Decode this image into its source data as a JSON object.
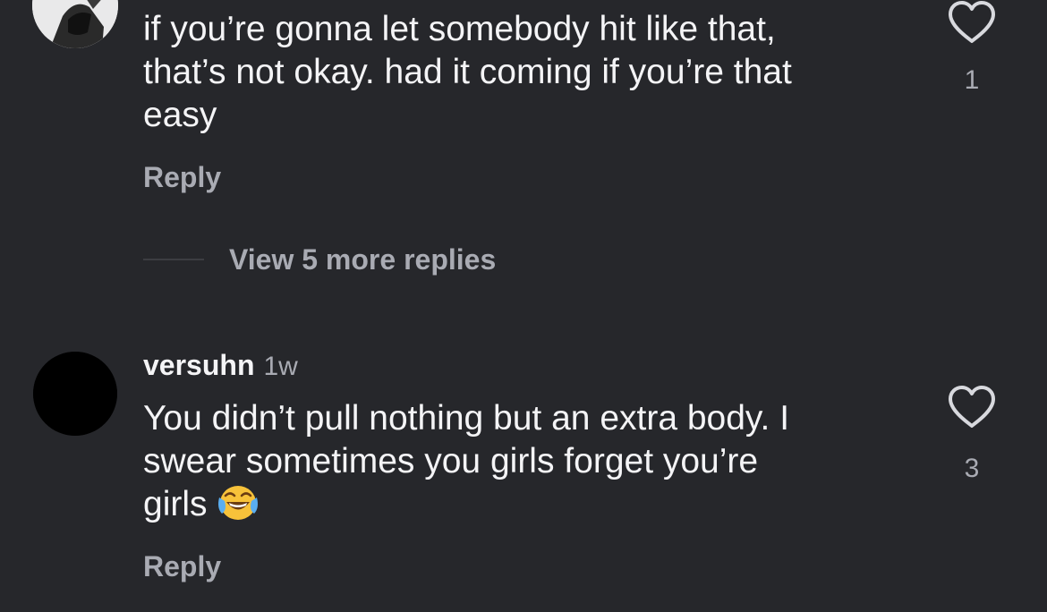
{
  "comments": [
    {
      "avatar_icon": "user-photo-avatar-icon",
      "text": "if you’re gonna let somebody hit like that,\nthat’s not okay. had it coming if you’re that\neasy",
      "reply_label": "Reply",
      "like_count": "1"
    },
    {
      "avatar_icon": "user-avatar-icon",
      "username": "versuhn",
      "timestamp": "1w",
      "text": "You didn’t pull nothing but an extra body. I\nswear sometimes you girls forget you’re\ngirls",
      "emoji_icon": "face-with-tears-of-joy-icon",
      "reply_label": "Reply",
      "like_count": "3"
    }
  ],
  "view_more_replies": "View 5 more replies",
  "colors": {
    "background": "#26272b",
    "primary_text": "#f4f4f6",
    "secondary_text": "#a9abb3",
    "heart_outline": "#d8d9de"
  }
}
